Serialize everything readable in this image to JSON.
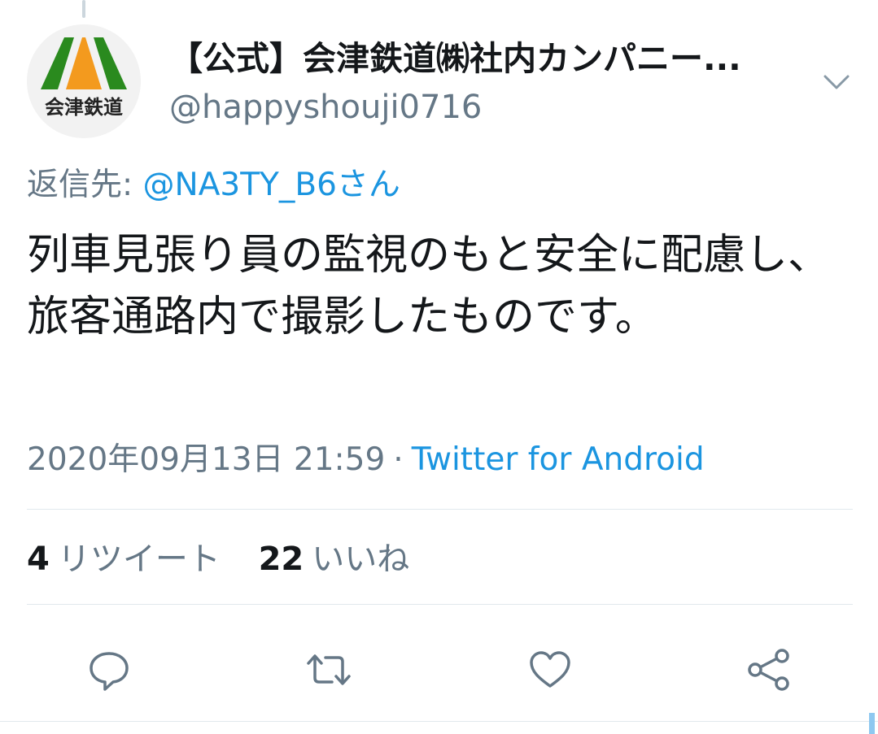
{
  "tweet": {
    "author": {
      "display_name": "【公式】会津鉄道㈱社内カンパニー...",
      "handle": "@happyshouji0716",
      "avatar_logo_text": "会津鉄道"
    },
    "reply_to": {
      "prefix": "返信先: ",
      "mention": "@NA3TY_B6さん"
    },
    "text": "列車見張り員の監視のもと安全に配慮し、旅客通路内で撮影したものです。",
    "timestamp": "2020年09月13日 21:59",
    "separator": "·",
    "source": "Twitter for Android",
    "stats": {
      "retweets": {
        "count": "4",
        "label": "リツイート"
      },
      "likes": {
        "count": "22",
        "label": "いいね"
      }
    },
    "actions": [
      {
        "icon": "reply-icon"
      },
      {
        "icon": "retweet-icon"
      },
      {
        "icon": "like-heart-icon"
      },
      {
        "icon": "share-icon"
      }
    ]
  },
  "colors": {
    "text_primary": "#14171a",
    "text_secondary": "#657786",
    "link": "#1b95e0",
    "divider": "#e1e8ed",
    "logo_green": "#2a8a1e",
    "logo_orange": "#f39a1e"
  }
}
